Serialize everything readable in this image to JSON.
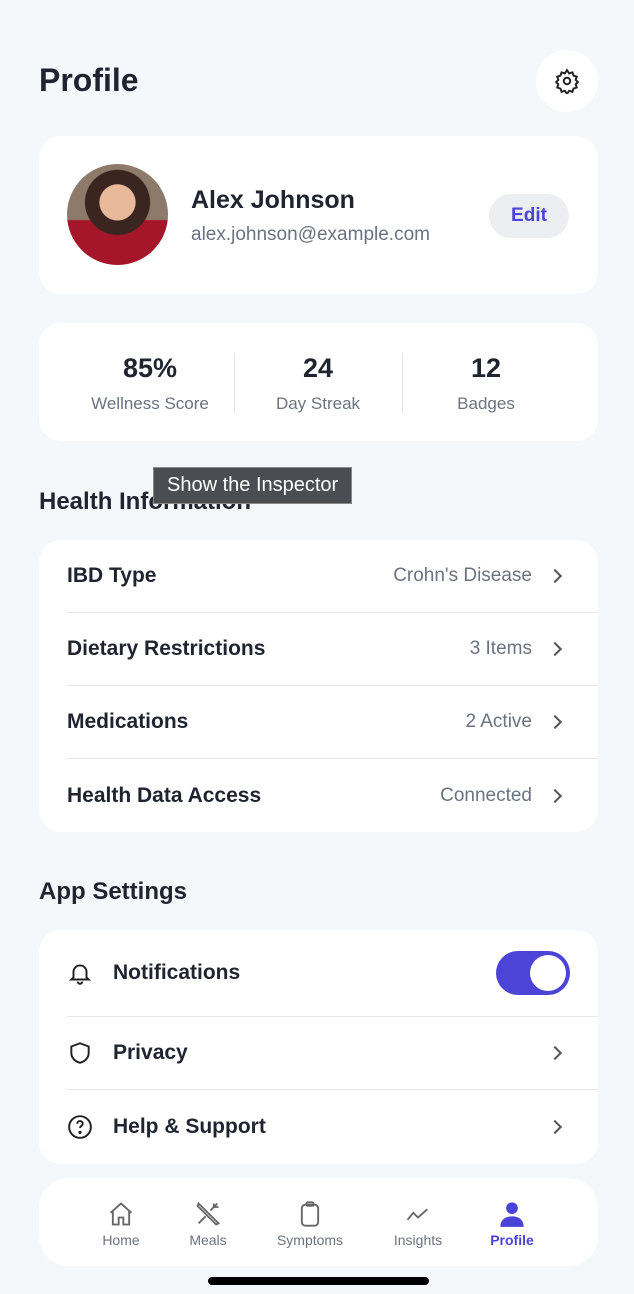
{
  "header": {
    "title": "Profile"
  },
  "user": {
    "name": "Alex Johnson",
    "email": "alex.johnson@example.com",
    "edit_label": "Edit"
  },
  "stats": [
    {
      "value": "85%",
      "label": "Wellness Score"
    },
    {
      "value": "24",
      "label": "Day Streak"
    },
    {
      "value": "12",
      "label": "Badges"
    }
  ],
  "tooltip": "Show the Inspector",
  "health": {
    "title": "Health Information",
    "items": [
      {
        "label": "IBD Type",
        "value": "Crohn's Disease"
      },
      {
        "label": "Dietary Restrictions",
        "value": "3 Items"
      },
      {
        "label": "Medications",
        "value": "2 Active"
      },
      {
        "label": "Health Data Access",
        "value": "Connected"
      }
    ]
  },
  "settings": {
    "title": "App Settings",
    "items": [
      {
        "label": "Notifications",
        "toggle": true
      },
      {
        "label": "Privacy"
      },
      {
        "label": "Help & Support"
      }
    ]
  },
  "nav": [
    {
      "label": "Home"
    },
    {
      "label": "Meals"
    },
    {
      "label": "Symptoms"
    },
    {
      "label": "Insights"
    },
    {
      "label": "Profile",
      "active": true
    }
  ],
  "colors": {
    "accent": "#4b44d6"
  }
}
